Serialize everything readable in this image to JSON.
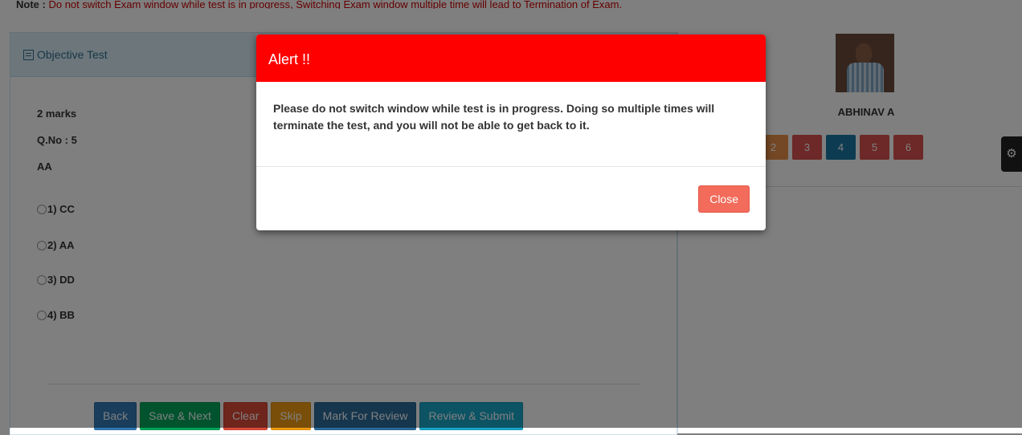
{
  "note": {
    "label": "Note :",
    "text": "Do not switch Exam window while test is in progress, Switching Exam window multiple time will lead to Termination of Exam."
  },
  "panel": {
    "title": "Objective Test"
  },
  "question": {
    "marks": "2 marks",
    "number": "Q.No : 5",
    "text": "AA"
  },
  "options": [
    "1) CC",
    "2) AA",
    "3) DD",
    "4) BB"
  ],
  "actions": {
    "back": "Back",
    "save_next": "Save & Next",
    "clear": "Clear",
    "skip": "Skip",
    "mark_review": "Mark For Review",
    "review_submit": "Review & Submit"
  },
  "candidate": {
    "name": "ABHINAV A"
  },
  "question_numbers": [
    {
      "label": "2",
      "color": "#e8914a"
    },
    {
      "label": "3",
      "color": "#d9534f"
    },
    {
      "label": "4",
      "color": "#1b78a5"
    },
    {
      "label": "5",
      "color": "#d9534f"
    },
    {
      "label": "6",
      "color": "#d9534f"
    }
  ],
  "modal": {
    "title": "Alert !!",
    "message": "Please do not switch window while test is in progress. Doing so multiple times will terminate the test, and you will not be able to get back to it.",
    "close_label": "Close"
  },
  "colors": {
    "alert_header": "#ff0000",
    "close_button": "#f26b5b"
  }
}
